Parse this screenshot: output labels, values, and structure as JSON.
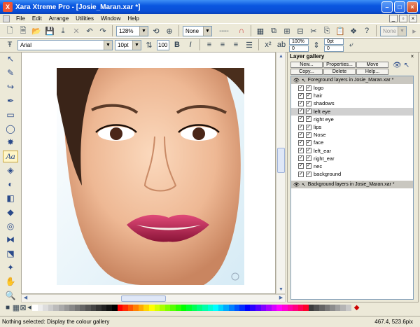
{
  "window": {
    "app_icon": "Xara-logo",
    "title": "Xara Xtreme Pro - [Josie_Maran.xar *]",
    "controls": [
      "minimize",
      "maximize",
      "close"
    ]
  },
  "menu": [
    "File",
    "Edit",
    "Arrange",
    "Utilities",
    "Window",
    "Help"
  ],
  "toolbar1": {
    "zoom_value": "128%",
    "line_style": "None",
    "quality": "None"
  },
  "toolbar2": {
    "font_name": "Arial",
    "font_size": "10pt",
    "kern": "100",
    "bold": "B",
    "italic": "I",
    "scale_a": "100%",
    "scale_b": "0",
    "spacing_a": "0pt",
    "spacing_b": "0"
  },
  "gallery": {
    "title": "Layer gallery",
    "buttons": [
      "New...",
      "Properties...",
      "Move",
      "Copy...",
      "Delete",
      "Help..."
    ],
    "foreground_group": "Foreground layers in Josie_Maran.xar *",
    "background_group": "Background layers in Josie_Maran.xar *",
    "layers": [
      "logo",
      "hair",
      "shadows",
      "left eye",
      "right eye",
      "lips",
      "Nose",
      "face",
      "left_ear",
      "right_ear",
      "nec",
      "background"
    ],
    "selected_layer": "left eye"
  },
  "status": {
    "message": "Nothing selected: Display the colour gallery",
    "coords": "467.4, 523.6pix"
  },
  "colors": {
    "accent": "#0a4fd6",
    "selection": "#d0d0d0",
    "lips": "#b8244e"
  }
}
